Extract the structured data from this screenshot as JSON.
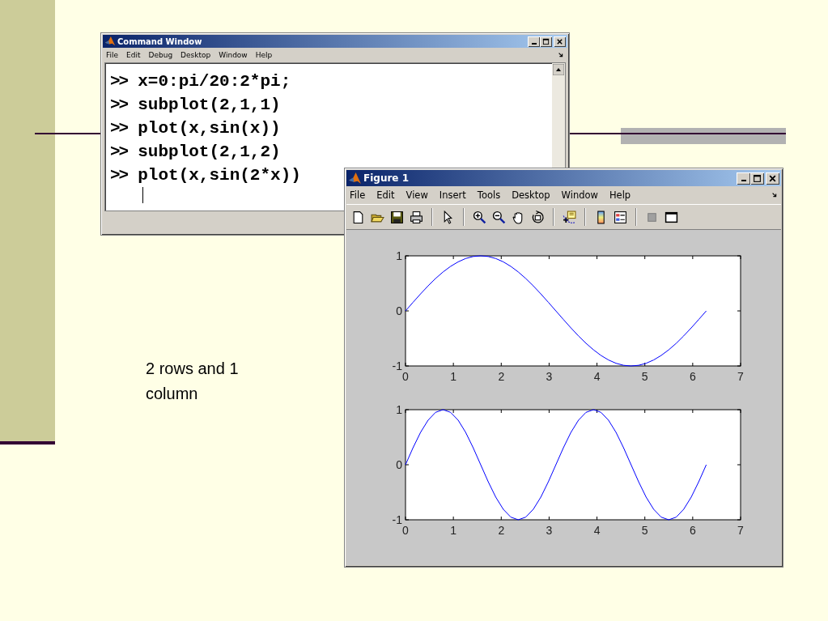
{
  "slide": {
    "caption": "2 rows and 1 column"
  },
  "command_window": {
    "title": "Command Window",
    "menu": [
      "File",
      "Edit",
      "Debug",
      "Desktop",
      "Window",
      "Help"
    ],
    "lines": [
      {
        "prompt": ">>",
        "code": "x=0:pi/20:2*pi;"
      },
      {
        "prompt": ">>",
        "code": "subplot(2,1,1)"
      },
      {
        "prompt": ">>",
        "code": "plot(x,sin(x))"
      },
      {
        "prompt": ">>",
        "code": "subplot(2,1,2)"
      },
      {
        "prompt": ">>",
        "code": "plot(x,sin(2*x))"
      }
    ]
  },
  "figure_window": {
    "title": "Figure 1",
    "menu": [
      "File",
      "Edit",
      "View",
      "Insert",
      "Tools",
      "Desktop",
      "Window",
      "Help"
    ],
    "subplots": [
      {
        "chart_data": {
          "type": "line",
          "x": [
            0,
            0.157,
            0.314,
            0.471,
            0.628,
            0.785,
            0.942,
            1.1,
            1.257,
            1.414,
            1.571,
            1.728,
            1.885,
            2.042,
            2.199,
            2.356,
            2.513,
            2.67,
            2.827,
            2.985,
            3.142,
            3.299,
            3.456,
            3.613,
            3.77,
            3.927,
            4.084,
            4.241,
            4.398,
            4.555,
            4.712,
            4.869,
            5.027,
            5.184,
            5.341,
            5.498,
            5.655,
            5.812,
            5.969,
            6.126,
            6.283
          ],
          "series": [
            {
              "color": "#0000ff",
              "values": [
                0,
                0.156,
                0.309,
                0.454,
                0.588,
                0.707,
                0.809,
                0.891,
                0.951,
                0.988,
                1,
                0.988,
                0.951,
                0.891,
                0.809,
                0.707,
                0.588,
                0.454,
                0.309,
                0.156,
                0,
                -0.156,
                -0.309,
                -0.454,
                -0.588,
                -0.707,
                -0.809,
                -0.891,
                -0.951,
                -0.988,
                -1,
                -0.988,
                -0.951,
                -0.891,
                -0.809,
                -0.707,
                -0.588,
                -0.454,
                -0.309,
                -0.156,
                0
              ]
            }
          ],
          "xlim": [
            0,
            7
          ],
          "ylim": [
            -1,
            1
          ],
          "xticks": [
            0,
            1,
            2,
            3,
            4,
            5,
            6,
            7
          ],
          "yticks": [
            -1,
            0,
            1
          ]
        }
      },
      {
        "chart_data": {
          "type": "line",
          "x": [
            0,
            0.157,
            0.314,
            0.471,
            0.628,
            0.785,
            0.942,
            1.1,
            1.257,
            1.414,
            1.571,
            1.728,
            1.885,
            2.042,
            2.199,
            2.356,
            2.513,
            2.67,
            2.827,
            2.985,
            3.142,
            3.299,
            3.456,
            3.613,
            3.77,
            3.927,
            4.084,
            4.241,
            4.398,
            4.555,
            4.712,
            4.869,
            5.027,
            5.184,
            5.341,
            5.498,
            5.655,
            5.812,
            5.969,
            6.126,
            6.283
          ],
          "series": [
            {
              "color": "#0000ff",
              "values": [
                0,
                0.309,
                0.588,
                0.809,
                0.951,
                1,
                0.951,
                0.809,
                0.588,
                0.309,
                0,
                -0.309,
                -0.588,
                -0.809,
                -0.951,
                -1,
                -0.951,
                -0.809,
                -0.588,
                -0.309,
                0,
                0.309,
                0.588,
                0.809,
                0.951,
                1,
                0.951,
                0.809,
                0.588,
                0.309,
                0,
                -0.309,
                -0.588,
                -0.809,
                -0.951,
                -1,
                -0.951,
                -0.809,
                -0.588,
                -0.309,
                0
              ]
            }
          ],
          "xlim": [
            0,
            7
          ],
          "ylim": [
            -1,
            1
          ],
          "xticks": [
            0,
            1,
            2,
            3,
            4,
            5,
            6,
            7
          ],
          "yticks": [
            -1,
            0,
            1
          ]
        }
      }
    ]
  }
}
